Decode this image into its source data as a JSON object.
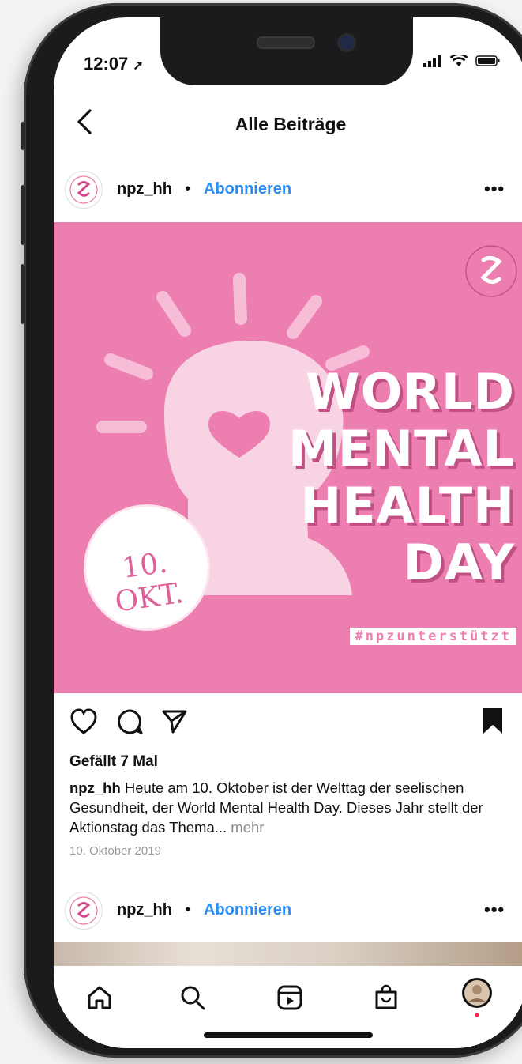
{
  "status": {
    "time": "12:07"
  },
  "nav": {
    "title": "Alle Beiträge",
    "back_icon": "chevron-left-icon"
  },
  "post": {
    "username": "npz_hh",
    "separator": "•",
    "follow_label": "Abonnieren",
    "more_label": "•••",
    "image": {
      "headline_lines": [
        "WORLD",
        "MENTAL",
        "HEALTH",
        "DAY"
      ],
      "date_badge": "10. OKT.",
      "hashtag": "#npzunterstützt",
      "background": "#ec7fb0"
    },
    "likes_text": "Gefällt 7 Mal",
    "caption_user": "npz_hh",
    "caption_text": "Heute am 10. Oktober ist der Welttag der seelischen Gesundheit, der World Mental Health Day. Dieses Jahr stellt der Aktionstag das Thema...",
    "caption_more": "mehr",
    "date": "10. Oktober 2019"
  },
  "post2": {
    "username": "npz_hh",
    "separator": "•",
    "follow_label": "Abonnieren",
    "more_label": "•••"
  },
  "tabbar": {
    "items": [
      "home-icon",
      "search-icon",
      "reels-icon",
      "shop-icon",
      "profile-avatar"
    ]
  },
  "colors": {
    "accent": "#2a8bf2",
    "pink": "#ec7fb0"
  }
}
